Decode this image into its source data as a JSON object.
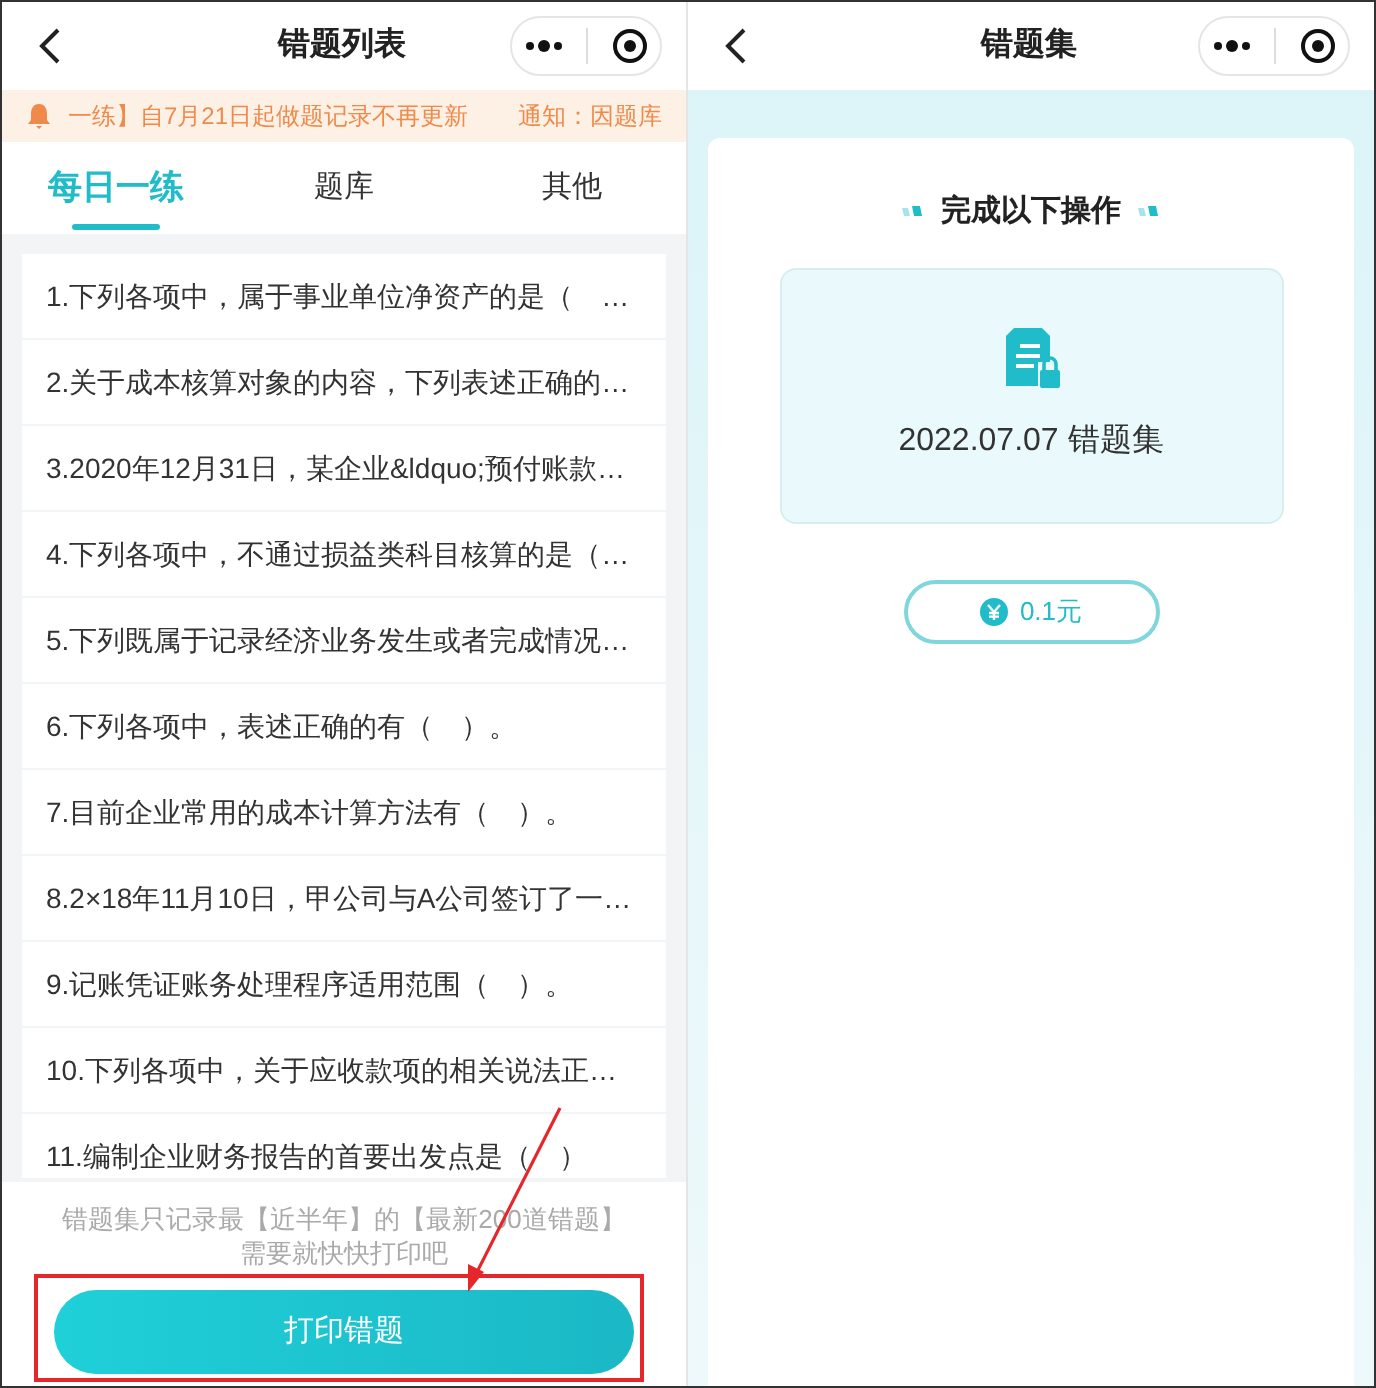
{
  "left_page": {
    "nav": {
      "title": "错题列表"
    },
    "notice": {
      "message": "一练】自7月21日起做题记录不再更新",
      "tail": "通知：因题库"
    },
    "tabs": [
      {
        "label": "每日一练",
        "selected": true
      },
      {
        "label": "题库",
        "selected": false
      },
      {
        "label": "其他",
        "selected": false
      }
    ],
    "questions": [
      "1.下列各项中，属于事业单位净资产的是（　…",
      "2.关于成本核算对象的内容，下列表述正确的…",
      "3.2020年12月31日，某企业&ldquo;预付账款…",
      "4.下列各项中，不通过损益类科目核算的是（…",
      "5.下列既属于记录经济业务发生或者完成情况…",
      "6.下列各项中，表述正确的有（　）。",
      "7.目前企业常用的成本计算方法有（　）。",
      "8.2×18年11月10日，甲公司与A公司签订了一…",
      "9.记账凭证账务处理程序适用范围（　）。",
      "10.下列各项中，关于应收款项的相关说法正…",
      "11.编制企业财务报告的首要出发点是（　）"
    ],
    "hint_lines": [
      "错题集只记录最【近半年】的【最新200道错题】",
      "需要就快快打印吧"
    ],
    "print_button": "打印错题"
  },
  "right_page": {
    "nav": {
      "title": "错题集"
    },
    "heading": "完成以下操作",
    "file_label": "2022.07.07 错题集",
    "price_button": "0.1元"
  }
}
